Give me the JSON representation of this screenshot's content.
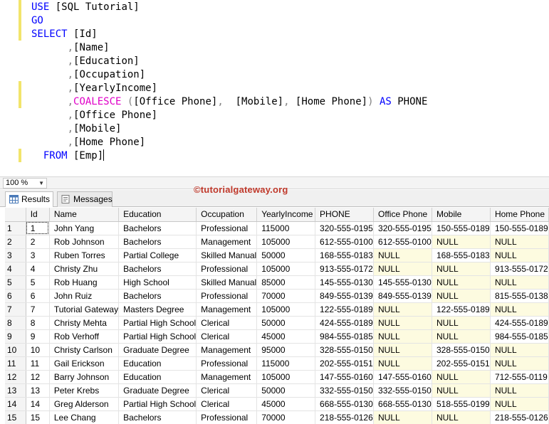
{
  "editor": {
    "lines": [
      [
        {
          "t": "USE",
          "c": "kw"
        },
        {
          "t": " [SQL Tutorial]"
        }
      ],
      [
        {
          "t": "GO",
          "c": "kw"
        }
      ],
      [
        {
          "t": "SELECT",
          "c": "kw"
        },
        {
          "t": " [Id]"
        }
      ],
      [
        {
          "t": "      ,",
          "c": "gr"
        },
        {
          "t": "[Name]"
        }
      ],
      [
        {
          "t": "      ,",
          "c": "gr"
        },
        {
          "t": "[Education]"
        }
      ],
      [
        {
          "t": "      ,",
          "c": "gr"
        },
        {
          "t": "[Occupation]"
        }
      ],
      [
        {
          "t": "      ,",
          "c": "gr"
        },
        {
          "t": "[YearlyIncome]"
        }
      ],
      [
        {
          "t": "      ,",
          "c": "gr"
        },
        {
          "t": "COALESCE",
          "c": "fn"
        },
        {
          "t": " (",
          "c": "gr"
        },
        {
          "t": "[Office Phone]"
        },
        {
          "t": ",",
          "c": "gr"
        },
        {
          "t": "  [Mobile]"
        },
        {
          "t": ",",
          "c": "gr"
        },
        {
          "t": " [Home Phone]"
        },
        {
          "t": ")",
          "c": "gr"
        },
        {
          "t": " AS",
          "c": "kw"
        },
        {
          "t": " PHONE"
        }
      ],
      [
        {
          "t": "      ,",
          "c": "gr"
        },
        {
          "t": "[Office Phone]"
        }
      ],
      [
        {
          "t": "      ,",
          "c": "gr"
        },
        {
          "t": "[Mobile]"
        }
      ],
      [
        {
          "t": "      ,",
          "c": "gr"
        },
        {
          "t": "[Home Phone]"
        }
      ],
      [
        {
          "t": "  FROM",
          "c": "kw"
        },
        {
          "t": " [Emp]"
        }
      ]
    ]
  },
  "zoom": "100 %",
  "tabs": {
    "results": "Results",
    "messages": "Messages"
  },
  "watermark": "©tutorialgateway.org",
  "grid": {
    "columns": [
      "Id",
      "Name",
      "Education",
      "Occupation",
      "YearlyIncome",
      "PHONE",
      "Office Phone",
      "Mobile",
      "Home Phone"
    ],
    "rows": [
      [
        "1",
        "John Yang",
        "Bachelors",
        "Professional",
        "115000",
        "320-555-0195",
        "320-555-0195",
        "150-555-0189",
        "150-555-0189"
      ],
      [
        "2",
        "Rob Johnson",
        "Bachelors",
        "Management",
        "105000",
        "612-555-0100",
        "612-555-0100",
        "NULL",
        "NULL"
      ],
      [
        "3",
        "Ruben Torres",
        "Partial College",
        "Skilled Manual",
        "50000",
        "168-555-0183",
        "NULL",
        "168-555-0183",
        "NULL"
      ],
      [
        "4",
        "Christy Zhu",
        "Bachelors",
        "Professional",
        "105000",
        "913-555-0172",
        "NULL",
        "NULL",
        "913-555-0172"
      ],
      [
        "5",
        "Rob Huang",
        "High School",
        "Skilled Manual",
        "85000",
        "145-555-0130",
        "145-555-0130",
        "NULL",
        "NULL"
      ],
      [
        "6",
        "John Ruiz",
        "Bachelors",
        "Professional",
        "70000",
        "849-555-0139",
        "849-555-0139",
        "NULL",
        "815-555-0138"
      ],
      [
        "7",
        "Tutorial Gateway",
        "Masters Degree",
        "Management",
        "105000",
        "122-555-0189",
        "NULL",
        "122-555-0189",
        "NULL"
      ],
      [
        "8",
        "Christy Mehta",
        "Partial High School",
        "Clerical",
        "50000",
        "424-555-0189",
        "NULL",
        "NULL",
        "424-555-0189"
      ],
      [
        "9",
        "Rob Verhoff",
        "Partial High School",
        "Clerical",
        "45000",
        "984-555-0185",
        "NULL",
        "NULL",
        "984-555-0185"
      ],
      [
        "10",
        "Christy Carlson",
        "Graduate Degree",
        "Management",
        "95000",
        "328-555-0150",
        "NULL",
        "328-555-0150",
        "NULL"
      ],
      [
        "11",
        "Gail Erickson",
        "Education",
        "Professional",
        "115000",
        "202-555-0151",
        "NULL",
        "202-555-0151",
        "NULL"
      ],
      [
        "12",
        "Barry Johnson",
        "Education",
        "Management",
        "105000",
        "147-555-0160",
        "147-555-0160",
        "NULL",
        "712-555-0119"
      ],
      [
        "13",
        "Peter Krebs",
        "Graduate Degree",
        "Clerical",
        "50000",
        "332-555-0150",
        "332-555-0150",
        "NULL",
        "NULL"
      ],
      [
        "14",
        "Greg Alderson",
        "Partial High School",
        "Clerical",
        "45000",
        "668-555-0130",
        "668-555-0130",
        "518-555-0199",
        "NULL"
      ],
      [
        "15",
        "Lee Chang",
        "Bachelors",
        "Professional",
        "70000",
        "218-555-0126",
        "NULL",
        "NULL",
        "218-555-0126"
      ]
    ]
  },
  "colors": {
    "keyword": "#0000ff",
    "function": "#e000c8",
    "null_cell": "#fdfbe0",
    "watermark": "#c0392b"
  }
}
